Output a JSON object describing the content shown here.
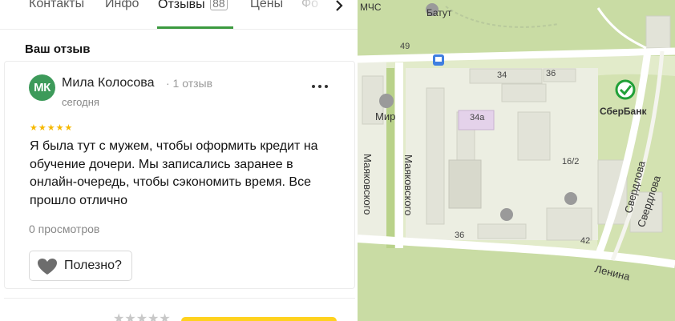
{
  "tabs": [
    {
      "label": "Контакты"
    },
    {
      "label": "Инфо"
    },
    {
      "label": "Отзывы",
      "count": "88",
      "active": true
    },
    {
      "label": "Цены"
    },
    {
      "label": "Фо"
    }
  ],
  "tabs_next_icon": "chevron-right-icon",
  "section_title": "Ваш отзыв",
  "review": {
    "avatar_initials": "МК",
    "avatar_color": "#3d9a5a",
    "author": "Мила Колосова",
    "author_meta": "· 1 отзыв",
    "date": "сегодня",
    "rating": 5,
    "rating_stars": "★★★★★",
    "text": "Я была тут с мужем, чтобы оформить кредит на обучение дочери. Мы записались заранее в онлайн-очередь, чтобы сэкономить время. Все прошло отлично",
    "views": "0 просмотров",
    "useful_label": "Полезно?",
    "more_icon": "more-horizontal-icon"
  },
  "bottom": {
    "stars": "★★★★★",
    "accent": "#ffd21e"
  },
  "map": {
    "labels": {
      "mchs": "МЧС",
      "batut": "Батут",
      "mir": "Мир",
      "sberbank": "СберБанк",
      "n49": "49",
      "n34": "34",
      "n36a": "36",
      "n34a": "34а",
      "n16_2": "16/2",
      "n36b": "36",
      "n42": "42"
    },
    "streets": {
      "mayakovskogo_1": "Маяковского",
      "mayakovskogo_2": "Маяковского",
      "sverdlova_1": "Свердлова",
      "sverdlova_2": "Свердлова",
      "lenina": "Ленина"
    },
    "colors": {
      "park": "#c7dba0",
      "block": "#eceee2",
      "road": "#ffffff",
      "sber": "#21a038"
    }
  },
  "colors": {
    "accent": "#3b9a3f",
    "star": "#f6b800"
  }
}
